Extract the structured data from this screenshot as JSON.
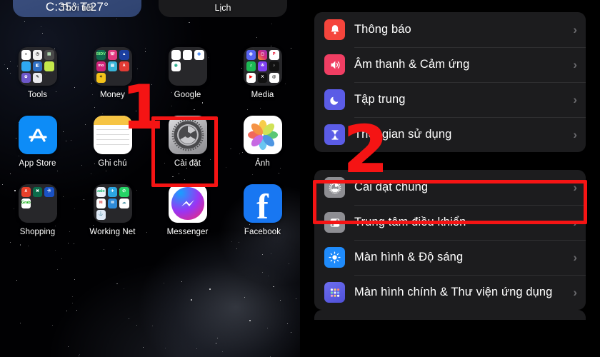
{
  "left_panel": {
    "name": "ios-home-screen",
    "widgets": [
      {
        "id": "weather",
        "value": "C:35° T:27°",
        "label": "Thời tiết"
      },
      {
        "id": "calendar",
        "value": "",
        "label": "Lịch"
      }
    ],
    "rows": [
      [
        {
          "label": "Tools",
          "type": "folder",
          "icon": "tools-folder-icon"
        },
        {
          "label": "Money",
          "type": "folder",
          "icon": "money-folder-icon"
        },
        {
          "label": "Google",
          "type": "folder",
          "icon": "google-folder-icon"
        },
        {
          "label": "Media",
          "type": "folder",
          "icon": "media-folder-icon"
        }
      ],
      [
        {
          "label": "App Store",
          "type": "app",
          "icon": "app-store-icon"
        },
        {
          "label": "Ghi chú",
          "type": "app",
          "icon": "notes-icon"
        },
        {
          "label": "Cài đặt",
          "type": "app",
          "icon": "settings-gear-icon"
        },
        {
          "label": "Ảnh",
          "type": "app",
          "icon": "photos-icon"
        }
      ],
      [
        {
          "label": "Shopping",
          "type": "folder",
          "icon": "shopping-folder-icon"
        },
        {
          "label": "Working Net",
          "type": "folder",
          "icon": "working-net-folder-icon"
        },
        {
          "label": "Messenger",
          "type": "app",
          "icon": "messenger-icon"
        },
        {
          "label": "Facebook",
          "type": "app",
          "icon": "facebook-icon"
        }
      ]
    ]
  },
  "right_panel": {
    "name": "ios-settings-list",
    "groups": [
      {
        "id": "group-1",
        "items": [
          {
            "label": "Thông báo",
            "icon": "bell-icon",
            "color": "#f5453c",
            "chevron": "›"
          },
          {
            "label": "Âm thanh & Cảm ứng",
            "icon": "speaker-icon",
            "color": "#f03e63",
            "chevron": "›"
          },
          {
            "label": "Tập trung",
            "icon": "moon-icon",
            "color": "#5b5ce6",
            "chevron": "›"
          },
          {
            "label": "Thời gian sử dụng",
            "icon": "hourglass-icon",
            "color": "#5b5ce6",
            "chevron": "›"
          }
        ]
      },
      {
        "id": "group-2",
        "items": [
          {
            "label": "Cài đặt chung",
            "icon": "gear-icon",
            "color": "#8e8e93",
            "chevron": "›",
            "highlighted": true
          },
          {
            "label": "Trung tâm điều khiển",
            "icon": "control-center-icon",
            "color": "#8e8e93",
            "chevron": "›"
          },
          {
            "label": "Màn hình & Độ sáng",
            "icon": "brightness-icon",
            "color": "#1f8bfb",
            "chevron": "›"
          },
          {
            "label": "Màn hình chính & Thư viện ứng dụng",
            "icon": "app-library-icon",
            "color": "#5b5ce6",
            "chevron": "›"
          }
        ]
      }
    ]
  },
  "annotations": {
    "step_one": {
      "text": "1",
      "target": "settings-app-icon",
      "color": "#f51414"
    },
    "step_two": {
      "text": "2",
      "target": "cai-dat-chung-row",
      "color": "#f51414"
    }
  },
  "colors": {
    "annotation_red": "#f51414",
    "settings_row_bg": "#1c1c1e",
    "settings_bg": "#000000",
    "label_white": "#ffffff",
    "chevron_gray": "#6a6a6e"
  }
}
